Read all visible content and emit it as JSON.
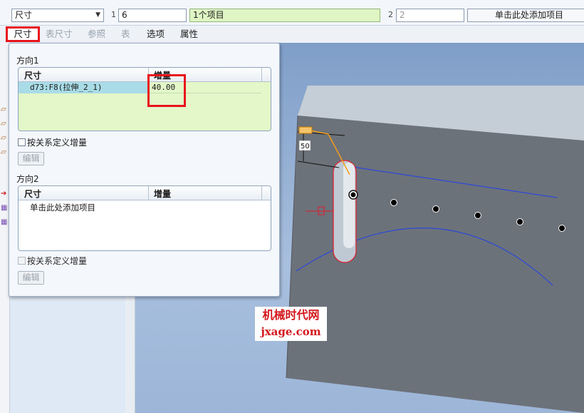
{
  "toolbar": {
    "dim_select": "尺寸",
    "ref1_num": "1",
    "ref1_value": "6",
    "ref1_items": "1个项目",
    "ref2_num": "2",
    "ref2_value": "2",
    "ref2_add": "单击此处添加项目"
  },
  "tabs": [
    {
      "label": "尺寸",
      "state": "active"
    },
    {
      "label": "表尺寸",
      "state": "disabled"
    },
    {
      "label": "参照",
      "state": "disabled"
    },
    {
      "label": "表",
      "state": "disabled"
    },
    {
      "label": "选项",
      "state": "enabled"
    },
    {
      "label": "属性",
      "state": "enabled"
    }
  ],
  "panel": {
    "direction1": {
      "title": "方向1",
      "col_dim": "尺寸",
      "col_inc": "增量",
      "rows": [
        {
          "dim": "d73:F8(拉伸_2_1)",
          "inc": "40.00"
        }
      ],
      "relation_checkbox": "按关系定义增量",
      "edit_button": "编辑"
    },
    "direction2": {
      "title": "方向2",
      "col_dim": "尺寸",
      "col_inc": "增量",
      "add_row": "单击此处添加项目",
      "relation_checkbox": "按关系定义增量",
      "edit_button": "编辑"
    }
  },
  "model": {
    "dim_label": "50"
  },
  "watermark": {
    "line1": "机械时代网",
    "line2": "jxage.com"
  },
  "colors": {
    "highlight": "#e8141c",
    "selected_field": "#dff5c4",
    "model_face": "#6c727a"
  }
}
